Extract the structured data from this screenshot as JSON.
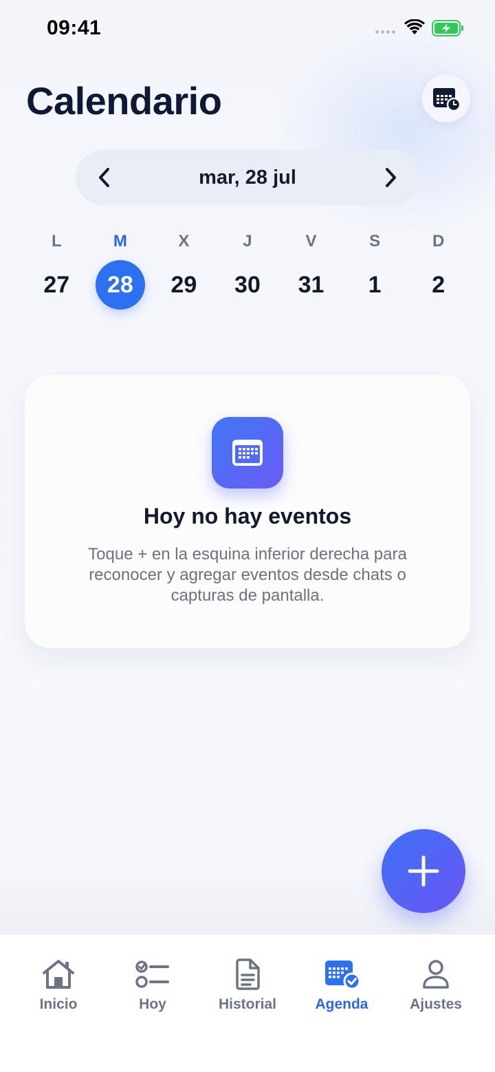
{
  "status_bar": {
    "time": "09:41"
  },
  "header": {
    "title": "Calendario",
    "action_icon": "calendar-clock-icon"
  },
  "date_nav": {
    "label": "mar, 28 jul",
    "prev_icon": "chevron-left-icon",
    "next_icon": "chevron-right-icon"
  },
  "week": {
    "days": [
      {
        "letter": "L",
        "number": "27"
      },
      {
        "letter": "M",
        "number": "28"
      },
      {
        "letter": "X",
        "number": "29"
      },
      {
        "letter": "J",
        "number": "30"
      },
      {
        "letter": "V",
        "number": "31"
      },
      {
        "letter": "S",
        "number": "1"
      },
      {
        "letter": "D",
        "number": "2"
      }
    ],
    "selected_index": 1
  },
  "empty_state": {
    "icon": "calendar-icon",
    "title": "Hoy no hay eventos",
    "description": "Toque + en la esquina inferior derecha para reconocer y agregar eventos desde chats o capturas de pantalla."
  },
  "fab": {
    "icon": "plus-icon"
  },
  "tab_bar": {
    "items": [
      {
        "label": "Inicio",
        "icon": "home-icon"
      },
      {
        "label": "Hoy",
        "icon": "checklist-icon"
      },
      {
        "label": "Historial",
        "icon": "document-icon"
      },
      {
        "label": "Agenda",
        "icon": "calendar-check-icon"
      },
      {
        "label": "Ajustes",
        "icon": "person-icon"
      }
    ],
    "active_index": 3
  },
  "colors": {
    "accent": "#2d70f0",
    "gradient_start": "#3c72f5",
    "gradient_end": "#6b55f5",
    "title": "#0e1a35"
  }
}
